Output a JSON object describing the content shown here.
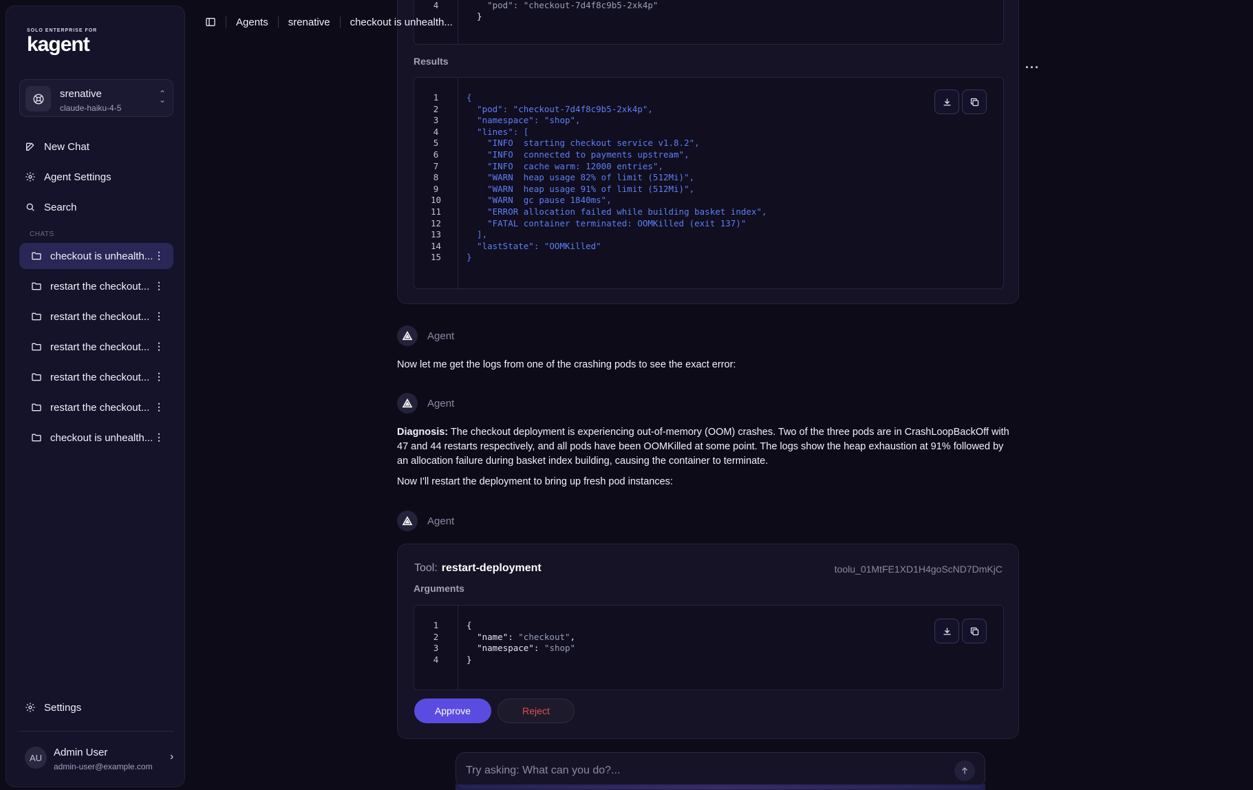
{
  "sidebar": {
    "logo_small": "SOLO ENTERPRISE FOR",
    "logo": "kagent",
    "agent": {
      "name": "srenative",
      "model": "claude-haiku-4-5"
    },
    "nav": {
      "new_chat": "New Chat",
      "agent_settings": "Agent Settings",
      "search": "Search"
    },
    "chats_label": "CHATS",
    "chats": [
      "checkout is unhealth...",
      "restart the checkout...",
      "restart the checkout...",
      "restart the checkout...",
      "restart the checkout...",
      "restart the checkout...",
      "checkout is unhealth..."
    ],
    "settings": "Settings",
    "user": {
      "initials": "AU",
      "name": "Admin User",
      "email": "admin-user@example.com"
    }
  },
  "breadcrumb": {
    "agents": "Agents",
    "agent": "srenative",
    "chat": "checkout is unhealth..."
  },
  "prev_tool": {
    "top_line_num": "4",
    "top_line": "    \"pod\": \"checkout-7d4f8c9b5-2xk4p\"",
    "top_line_num2": "",
    "top_close": "  }",
    "results_label": "Results",
    "results": [
      "{",
      "  \"pod\": \"checkout-7d4f8c9b5-2xk4p\",",
      "  \"namespace\": \"shop\",",
      "  \"lines\": [",
      "    \"INFO  starting checkout service v1.8.2\",",
      "    \"INFO  connected to payments upstream\",",
      "    \"INFO  cache warm: 12000 entries\",",
      "    \"WARN  heap usage 82% of limit (512Mi)\",",
      "    \"WARN  heap usage 91% of limit (512Mi)\",",
      "    \"WARN  gc pause 1840ms\",",
      "    \"ERROR allocation failed while building basket index\",",
      "    \"FATAL container terminated: OOMKilled (exit 137)\"",
      "  ],",
      "  \"lastState\": \"OOMKilled\"",
      "}"
    ]
  },
  "messages": {
    "agent_label": "Agent",
    "m1": "Now let me get the logs from one of the crashing pods to see the exact error:",
    "m2_bold": "Diagnosis:",
    "m2": " The checkout deployment is experiencing out-of-memory (OOM) crashes. Two of the three pods are in CrashLoopBackOff with 47 and 44 restarts respectively, and all pods have been OOMKilled at some point. The logs show the heap exhaustion at 91% followed by an allocation failure during basket index building, causing the container to terminate.",
    "m3": "Now I'll restart the deployment to bring up fresh pod instances:"
  },
  "tool": {
    "prefix": "Tool:",
    "name": "restart-deployment",
    "id": "toolu_01MtFE1XD1H4goScND7DmKjC",
    "args_label": "Arguments",
    "args": [
      {
        "k": "",
        "v": "",
        "raw": "{"
      },
      {
        "k": "\"name\"",
        "v": "\"checkout\"",
        "raw": ""
      },
      {
        "k": "\"namespace\"",
        "v": "\"shop\"",
        "raw": ""
      },
      {
        "k": "",
        "v": "",
        "raw": "}"
      }
    ],
    "approve": "Approve",
    "reject": "Reject"
  },
  "composer": {
    "placeholder": "Try asking: What can you do?..."
  },
  "colors": {
    "accent": "#5a4ce0",
    "reject": "#e0524f",
    "code": "#5e7ff5"
  }
}
